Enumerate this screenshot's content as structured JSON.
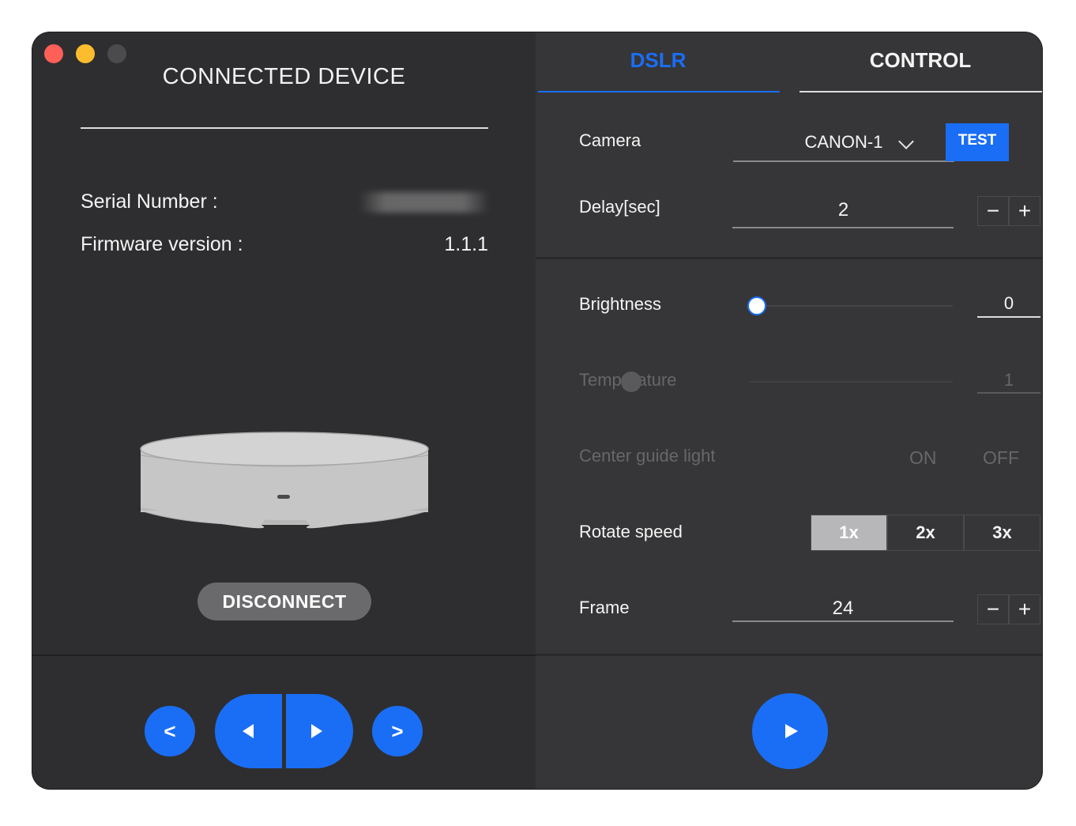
{
  "left_panel": {
    "title": "CONNECTED DEVICE",
    "serial_label": "Serial Number :",
    "firmware_label": "Firmware version :",
    "firmware_value": "1.1.1",
    "disconnect_label": "DISCONNECT",
    "nav": {
      "prev_label": "<",
      "next_label": ">"
    }
  },
  "tabs": [
    {
      "label": "DSLR",
      "active": true
    },
    {
      "label": "CONTROL",
      "active": false
    }
  ],
  "dslr": {
    "camera_label": "Camera",
    "camera_value": "CANON-1",
    "test_label": "TEST",
    "delay_label": "Delay[sec]",
    "delay_value": "2",
    "minus_symbol": "−",
    "plus_symbol": "+"
  },
  "control": {
    "brightness_label": "Brightness",
    "brightness_value": "0",
    "brightness_level": 0,
    "temperature_label": "Temperature",
    "temperature_value": "1",
    "temperature_enabled": false,
    "center_guide_label": "Center guide light",
    "on_label": "ON",
    "off_label": "OFF",
    "rotate_speed_label": "Rotate speed",
    "rotate_speeds": [
      "1x",
      "2x",
      "3x"
    ],
    "rotate_speed_selected": "1x",
    "frame_label": "Frame",
    "frame_value": "24"
  },
  "colors": {
    "accent": "#1a6ef5",
    "panel_left": "#2e2e30",
    "panel_right": "#363638"
  },
  "icons": {
    "close": "close-icon",
    "minimize": "minimize-icon",
    "zoom": "zoom-icon",
    "dropdown": "chevron-down-icon",
    "rotate_left": "triangle-left-icon",
    "rotate_right": "triangle-right-icon",
    "play": "play-icon"
  }
}
